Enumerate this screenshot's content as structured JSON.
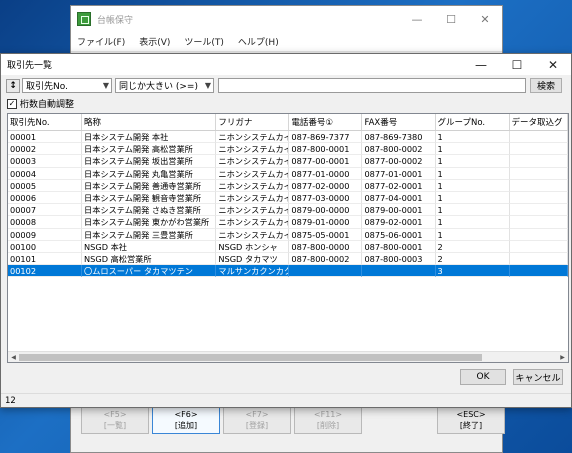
{
  "background_window": {
    "title": "台帳保守",
    "controls": [
      "—",
      "☐",
      "✕"
    ],
    "menu": [
      "ファイル(F)",
      "表示(V)",
      "ツール(T)",
      "ヘルプ(H)"
    ],
    "function_keys": [
      {
        "key": "<F5>",
        "label": "[一覧]",
        "enabled": false
      },
      {
        "key": "<F6>",
        "label": "[追加]",
        "enabled": true
      },
      {
        "key": "<F7>",
        "label": "[登録]",
        "enabled": false
      },
      {
        "key": "<F11>",
        "label": "[削除]",
        "enabled": false
      },
      {
        "key": "<ESC>",
        "label": "[終了]",
        "enabled": true
      }
    ]
  },
  "dialog": {
    "title": "取引先一覧",
    "controls": [
      "—",
      "☐",
      "✕"
    ],
    "filter": {
      "sort_icon": "↕",
      "field_value": "取引先No.",
      "operator_value": "同じか大きい (>=)",
      "search_value": "",
      "search_button": "検索"
    },
    "autofit": {
      "label": "桁数自動調整",
      "checked": true,
      "mark": "✓"
    },
    "table": {
      "columns": [
        "取引先No.",
        "略称",
        "フリガナ",
        "電話番号①",
        "FAX番号",
        "グループNo.",
        "データ取込グ"
      ],
      "rows": [
        [
          "00001",
          "日本システム開発 本社",
          "ニホンシステムカイハツ...",
          "087-869-7377",
          "087-869-7380",
          "1",
          ""
        ],
        [
          "00002",
          "日本システム開発 高松営業所",
          "ニホンシステムカイハツ...",
          "087-800-0001",
          "087-800-0002",
          "1",
          ""
        ],
        [
          "00003",
          "日本システム開発 坂出営業所",
          "ニホンシステムカイハツ...",
          "0877-00-0001",
          "0877-00-0002",
          "1",
          ""
        ],
        [
          "00004",
          "日本システム開発 丸亀営業所",
          "ニホンシステムカイハツ...",
          "0877-01-0000",
          "0877-01-0001",
          "1",
          ""
        ],
        [
          "00005",
          "日本システム開発 善通寺営業所",
          "ニホンシステムカイハツ...",
          "0877-02-0000",
          "0877-02-0001",
          "1",
          ""
        ],
        [
          "00006",
          "日本システム開発 観音寺営業所",
          "ニホンシステムカイハツ...",
          "0877-03-0000",
          "0877-04-0001",
          "1",
          ""
        ],
        [
          "00007",
          "日本システム開発 さぬき営業所",
          "ニホンシステムカイハツ...",
          "0879-00-0000",
          "0879-00-0001",
          "1",
          ""
        ],
        [
          "00008",
          "日本システム開発 東かがわ営業所",
          "ニホンシステムカイハツ...",
          "0879-01-0000",
          "0879-02-0001",
          "1",
          ""
        ],
        [
          "00009",
          "日本システム開発 三豊営業所",
          "ニホンシステムカイハツ...",
          "0875-05-0001",
          "0875-06-0001",
          "1",
          ""
        ],
        [
          "00100",
          "NSGD 本社",
          "NSGD ホンシャ",
          "087-800-0000",
          "087-800-0001",
          "2",
          ""
        ],
        [
          "00101",
          "NSGD 高松営業所",
          "NSGD タカマツ",
          "087-800-0002",
          "087-800-0003",
          "2",
          ""
        ],
        [
          "00102",
          "〇ムロスーパー タカマツテン",
          "マルサンカクンカクスー...",
          "",
          "",
          "3",
          ""
        ]
      ],
      "selected_row": 11
    },
    "ok_button": "OK",
    "cancel_button": "キャンセル",
    "status_text": "12"
  }
}
